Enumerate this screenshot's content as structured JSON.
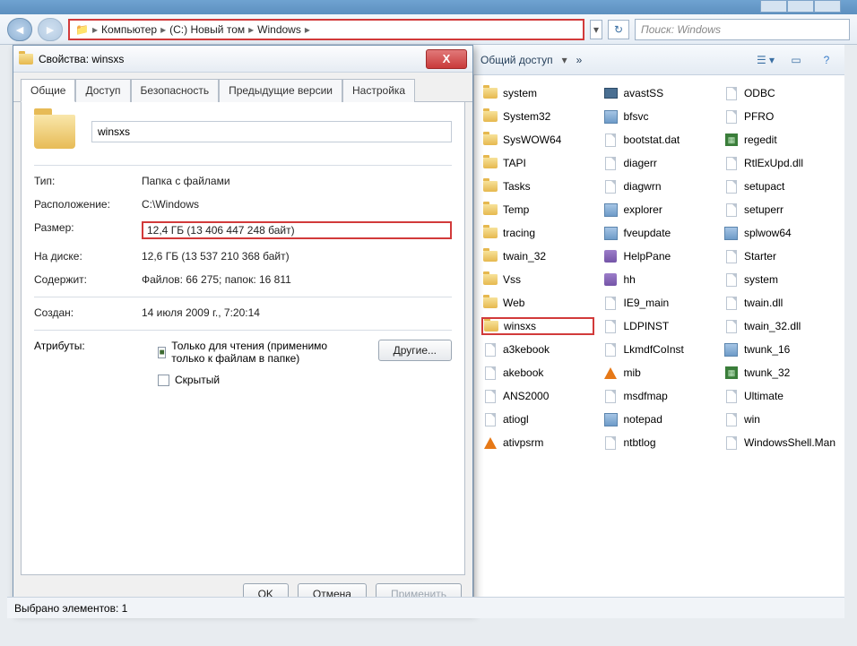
{
  "breadcrumb": {
    "parts": [
      "Компьютер",
      "(C:) Новый том",
      "Windows"
    ]
  },
  "search": {
    "placeholder": "Поиск: Windows"
  },
  "toolbar": {
    "share": "Общий доступ"
  },
  "statusbar": {
    "text": "Выбрано элементов: 1"
  },
  "props": {
    "title": "Свойства: winsxs",
    "tabs": {
      "general": "Общие",
      "access": "Доступ",
      "security": "Безопасность",
      "prev": "Предыдущие версии",
      "cfg": "Настройка"
    },
    "name": "winsxs",
    "labels": {
      "type": "Тип:",
      "location": "Расположение:",
      "size": "Размер:",
      "ondisk": "На диске:",
      "contains": "Содержит:",
      "created": "Создан:",
      "attrs": "Атрибуты:",
      "readonly": "Только для чтения (применимо только к файлам в папке)",
      "hidden": "Скрытый",
      "more": "Другие...",
      "ok": "OK",
      "cancel": "Отмена",
      "apply": "Применить"
    },
    "values": {
      "type": "Папка с файлами",
      "location": "C:\\Windows",
      "size": "12,4 ГБ (13 406 447 248 байт)",
      "ondisk": "12,6 ГБ (13 537 210 368 байт)",
      "contains": "Файлов: 66 275; папок: 16 811",
      "created": "14 июля 2009 г., 7:20:14"
    }
  },
  "files": {
    "col1": [
      {
        "n": "system",
        "i": "folder"
      },
      {
        "n": "System32",
        "i": "folder"
      },
      {
        "n": "SysWOW64",
        "i": "folder"
      },
      {
        "n": "TAPI",
        "i": "folder"
      },
      {
        "n": "Tasks",
        "i": "folder"
      },
      {
        "n": "Temp",
        "i": "folder"
      },
      {
        "n": "tracing",
        "i": "folder"
      },
      {
        "n": "twain_32",
        "i": "folder"
      },
      {
        "n": "Vss",
        "i": "folder"
      },
      {
        "n": "Web",
        "i": "folder"
      },
      {
        "n": "winsxs",
        "i": "folder",
        "sel": true
      },
      {
        "n": "a3kebook",
        "i": "file"
      },
      {
        "n": "akebook",
        "i": "file"
      },
      {
        "n": "ANS2000",
        "i": "file"
      },
      {
        "n": "atiogl",
        "i": "file"
      },
      {
        "n": "ativpsrm",
        "i": "vlc"
      }
    ],
    "col2": [
      {
        "n": "avastSS",
        "i": "monitor"
      },
      {
        "n": "bfsvc",
        "i": "app"
      },
      {
        "n": "bootstat.dat",
        "i": "file"
      },
      {
        "n": "diagerr",
        "i": "file"
      },
      {
        "n": "diagwrn",
        "i": "file"
      },
      {
        "n": "explorer",
        "i": "app"
      },
      {
        "n": "fveupdate",
        "i": "app"
      },
      {
        "n": "HelpPane",
        "i": "chm"
      },
      {
        "n": "hh",
        "i": "chm"
      },
      {
        "n": "IE9_main",
        "i": "file"
      },
      {
        "n": "LDPINST",
        "i": "file"
      },
      {
        "n": "LkmdfCoInst",
        "i": "file"
      },
      {
        "n": "mib",
        "i": "vlc"
      },
      {
        "n": "msdfmap",
        "i": "file"
      },
      {
        "n": "notepad",
        "i": "app"
      },
      {
        "n": "ntbtlog",
        "i": "file"
      }
    ],
    "col3": [
      {
        "n": "ODBC",
        "i": "file"
      },
      {
        "n": "PFRO",
        "i": "file"
      },
      {
        "n": "regedit",
        "i": "reg"
      },
      {
        "n": "RtlExUpd.dll",
        "i": "file"
      },
      {
        "n": "setupact",
        "i": "file"
      },
      {
        "n": "setuperr",
        "i": "file"
      },
      {
        "n": "splwow64",
        "i": "app"
      },
      {
        "n": "Starter",
        "i": "file"
      },
      {
        "n": "system",
        "i": "file"
      },
      {
        "n": "twain.dll",
        "i": "file"
      },
      {
        "n": "twain_32.dll",
        "i": "file"
      },
      {
        "n": "twunk_16",
        "i": "app"
      },
      {
        "n": "twunk_32",
        "i": "reg"
      },
      {
        "n": "Ultimate",
        "i": "file"
      },
      {
        "n": "win",
        "i": "file"
      },
      {
        "n": "WindowsShell.Man",
        "i": "file"
      }
    ]
  }
}
